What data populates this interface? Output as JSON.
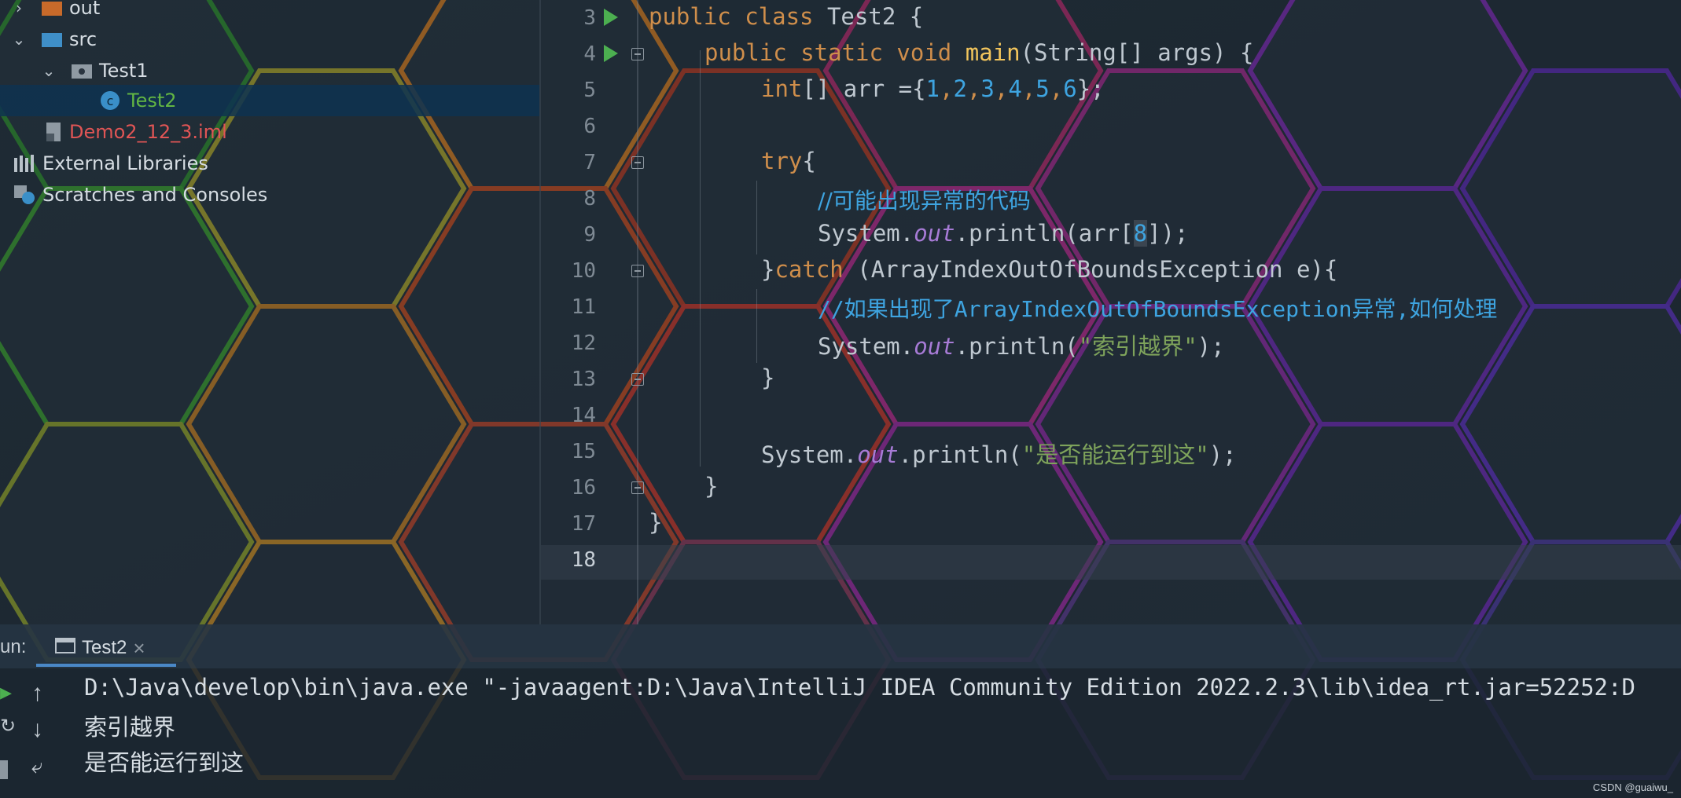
{
  "project_tree": {
    "items": [
      {
        "label": "out",
        "color": "#d6dde3"
      },
      {
        "label": "src",
        "color": "#d6dde3"
      },
      {
        "label": "Test1",
        "color": "#d6dde3"
      },
      {
        "label": "Test2",
        "color": "#62b543"
      },
      {
        "label": "Demo2_12_3.iml",
        "color": "#e05555"
      },
      {
        "label": "External Libraries",
        "color": "#d6dde3"
      },
      {
        "label": "Scratches and Consoles",
        "color": "#d6dde3"
      }
    ]
  },
  "editor": {
    "line_numbers": [
      "3",
      "4",
      "5",
      "6",
      "7",
      "8",
      "9",
      "10",
      "11",
      "12",
      "13",
      "14",
      "15",
      "16",
      "17",
      "18"
    ],
    "line3": {
      "kw": "public class",
      "rest": " Test2 {"
    },
    "line4": {
      "kw": "public static void",
      "fn": "main",
      "rest": "(String[] args) {"
    },
    "line5": {
      "kw": "int",
      "mid": "[] arr ={",
      "nums": [
        "1",
        "2",
        "3",
        "4",
        "5",
        "6"
      ],
      "end": "};"
    },
    "line7": {
      "kw": "try",
      "rest": "{"
    },
    "line8": {
      "comment": "//可能出现异常的代码"
    },
    "line9": {
      "a": "System.",
      "st": "out",
      "b": ".println(arr[",
      "idx": "8",
      "c": "]);"
    },
    "line10": {
      "a": "}",
      "kw": "catch",
      "b": " (ArrayIndexOutOfBoundsException e){"
    },
    "line11": {
      "comment": "//如果出现了ArrayIndexOutOfBoundsException异常,如何处理"
    },
    "line12": {
      "a": "System.",
      "st": "out",
      "b": ".println(",
      "str": "\"索引越界\"",
      "c": ");"
    },
    "line13": {
      "a": "}"
    },
    "line15": {
      "a": "System.",
      "st": "out",
      "b": ".println(",
      "str": "\"是否能运行到这\"",
      "c": ");"
    },
    "line16": {
      "a": "}"
    },
    "line17": {
      "a": "}"
    }
  },
  "run_panel": {
    "label": "un:",
    "tab_label": "Test2",
    "close": "×"
  },
  "console": {
    "lines": [
      "D:\\Java\\develop\\bin\\java.exe \"-javaagent:D:\\Java\\IntelliJ IDEA Community Edition 2022.2.3\\lib\\idea_rt.jar=52252:D",
      "索引越界",
      "是否能运行到这"
    ]
  },
  "watermark": "CSDN @guaiwu_"
}
